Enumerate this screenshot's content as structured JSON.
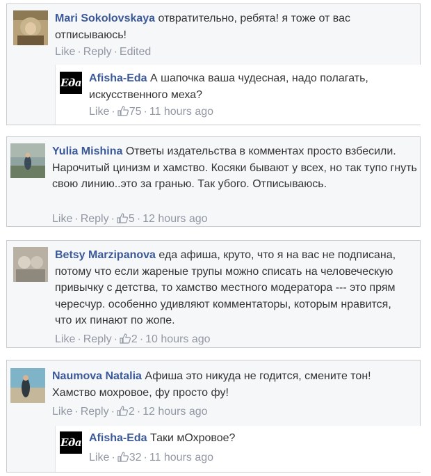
{
  "actions": {
    "like": "Like",
    "reply": "Reply",
    "edited": "Edited",
    "sep": "·"
  },
  "comments": [
    {
      "author": "Mari Sokolovskaya",
      "text": "отвратительно, ребята! я тоже от вас отписываюсь!",
      "reply": {
        "author": "Afisha-Eda",
        "logo_text": "Еда",
        "text": "А шапочка ваша чудесная, надо полагать, искусственного меха?",
        "likes": "75",
        "time": "11 hours ago"
      }
    },
    {
      "author": "Yulia Mishina",
      "text": "Ответы издательства в комментах просто взбесили. Нарочитый цинизм и хамство. Косяки бывают у всех, но так тупо гнуть свою линию..это за гранью. Так убого. Отписываюсь.",
      "likes": "5",
      "time": "12 hours ago"
    },
    {
      "author": "Betsy Marzipanova",
      "text": "еда афиша, круто, что я на вас не подписана, потому что если жареные трупы можно списать на человеческую привычку с детства, то хамство местного модератора --- это прям чересчур. особенно удивляют комментаторы, которым нравится, что их пинают по жопе.",
      "likes": "2",
      "time": "10 hours ago"
    },
    {
      "author": "Naumova Natalia",
      "text": "Афиша это никуда не годится, смените тон! Хамство мохровое, фу просто фу!",
      "likes": "2",
      "time": "12 hours ago",
      "reply": {
        "author": "Afisha-Eda",
        "logo_text": "Еда",
        "text": "Таки мОхровое?",
        "likes": "32",
        "time": "11 hours ago"
      }
    }
  ],
  "colors": {
    "name": "#3b5998",
    "meta": "#9197a3",
    "card_bg": "#f6f7f9",
    "border": "#c9cbd0"
  }
}
